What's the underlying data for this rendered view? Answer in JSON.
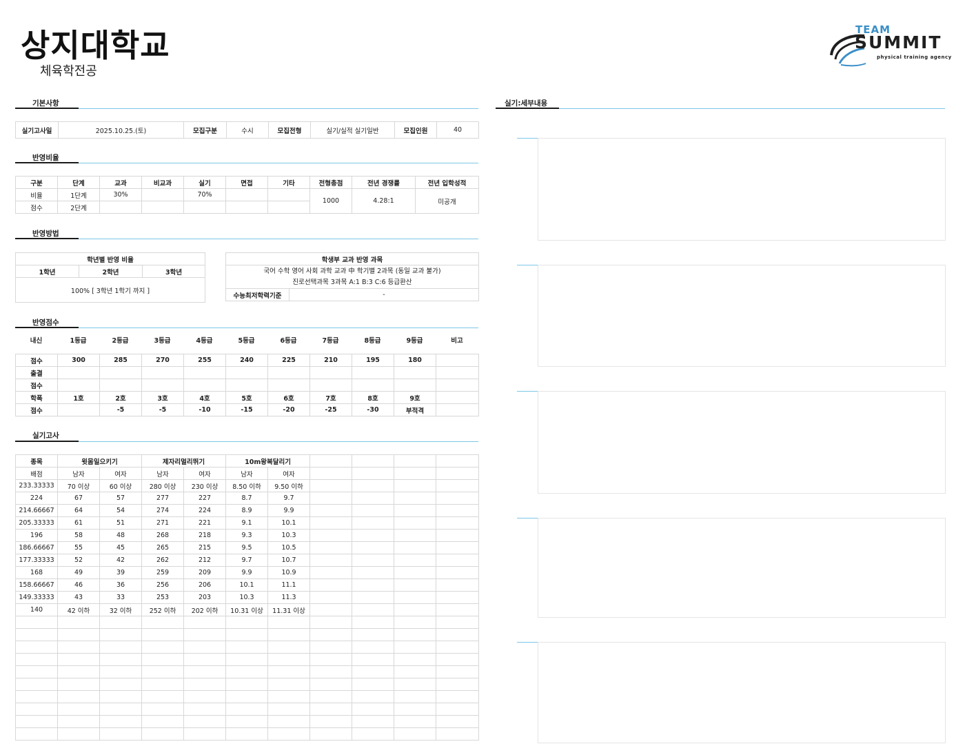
{
  "header": {
    "university": "상지대학교",
    "department": "체육학전공"
  },
  "logo": {
    "team": "TEAM",
    "brand": "SUMMIT",
    "tagline": "physical training agency",
    "color_main": "#1f1f1f",
    "color_accent": "#3a8fc7"
  },
  "sections": {
    "basic": "기본사항",
    "ratio": "반영비율",
    "method": "반영방법",
    "score": "반영점수",
    "practical": "실기고사",
    "detail": "실기:세부내용"
  },
  "basic": {
    "exam_date_label": "실기고사일",
    "exam_date": "2025.10.25.(토)",
    "category_label": "모집구분",
    "category": "수시",
    "type_label": "모집전형",
    "type": "실기/실적 실기일반",
    "quota_label": "모집인원",
    "quota": "40"
  },
  "ratio": {
    "headers": [
      "구분",
      "단계",
      "교과",
      "비교과",
      "실기",
      "면접",
      "기타",
      "전형총점",
      "전년 경쟁률",
      "전년 입학성적"
    ],
    "row1": {
      "label": "비율",
      "stage": "1단계",
      "subject": "30%",
      "nonsubject": "",
      "practical": "70%",
      "interview": "",
      "etc": ""
    },
    "row2": {
      "label": "점수",
      "stage": "2단계"
    },
    "total": "1000",
    "competition": "4.28:1",
    "prev_score": "미공개"
  },
  "method": {
    "grade_title": "학년별 반영 비율",
    "grades": [
      "1학년",
      "2학년",
      "3학년"
    ],
    "grade_value": "100% [ 3학년 1학기 까지 ]",
    "subject_title": "학생부 교과 반영 과목",
    "subject_line1": "국어 수학 영어 사회 과학 교과 中 학기별 2과목 (동일 교과 불가)",
    "subject_line2": "진로선택과목 3과목 A:1 B:3 C:6 등급환산",
    "csat_label": "수능최저학력기준",
    "csat_value": "-"
  },
  "score": {
    "headers": [
      "내신",
      "1등급",
      "2등급",
      "3등급",
      "4등급",
      "5등급",
      "6등급",
      "7등급",
      "8등급",
      "9등급",
      "비고"
    ],
    "rows": [
      [
        "점수",
        "300",
        "285",
        "270",
        "255",
        "240",
        "225",
        "210",
        "195",
        "180",
        ""
      ],
      [
        "출결",
        "",
        "",
        "",
        "",
        "",
        "",
        "",
        "",
        "",
        ""
      ],
      [
        "점수",
        "",
        "",
        "",
        "",
        "",
        "",
        "",
        "",
        "",
        ""
      ],
      [
        "학폭",
        "1호",
        "2호",
        "3호",
        "4호",
        "5호",
        "6호",
        "7호",
        "8호",
        "9호",
        ""
      ],
      [
        "점수",
        "",
        "-5",
        "-5",
        "-10",
        "-15",
        "-20",
        "-25",
        "-30",
        "부적격",
        ""
      ]
    ]
  },
  "practical": {
    "header": [
      "종목",
      "윗몸일으키기",
      "제자리멀리뛰기",
      "10m왕복달리기"
    ],
    "subheader": [
      "배점",
      "남자",
      "여자",
      "남자",
      "여자",
      "남자",
      "여자"
    ],
    "rows": [
      [
        "233.33333",
        "70 이상",
        "60 이상",
        "280 이상",
        "230 이상",
        "8.50 이하",
        "9.50 이하"
      ],
      [
        "224",
        "67",
        "57",
        "277",
        "227",
        "8.7",
        "9.7"
      ],
      [
        "214.66667",
        "64",
        "54",
        "274",
        "224",
        "8.9",
        "9.9"
      ],
      [
        "205.33333",
        "61",
        "51",
        "271",
        "221",
        "9.1",
        "10.1"
      ],
      [
        "196",
        "58",
        "48",
        "268",
        "218",
        "9.3",
        "10.3"
      ],
      [
        "186.66667",
        "55",
        "45",
        "265",
        "215",
        "9.5",
        "10.5"
      ],
      [
        "177.33333",
        "52",
        "42",
        "262",
        "212",
        "9.7",
        "10.7"
      ],
      [
        "168",
        "49",
        "39",
        "259",
        "209",
        "9.9",
        "10.9"
      ],
      [
        "158.66667",
        "46",
        "36",
        "256",
        "206",
        "10.1",
        "11.1"
      ],
      [
        "149.33333",
        "43",
        "33",
        "253",
        "203",
        "10.3",
        "11.3"
      ],
      [
        "140",
        "42 이하",
        "32 이하",
        "252 이하",
        "202 이하",
        "10.31 이상",
        "11.31 이상"
      ]
    ]
  }
}
